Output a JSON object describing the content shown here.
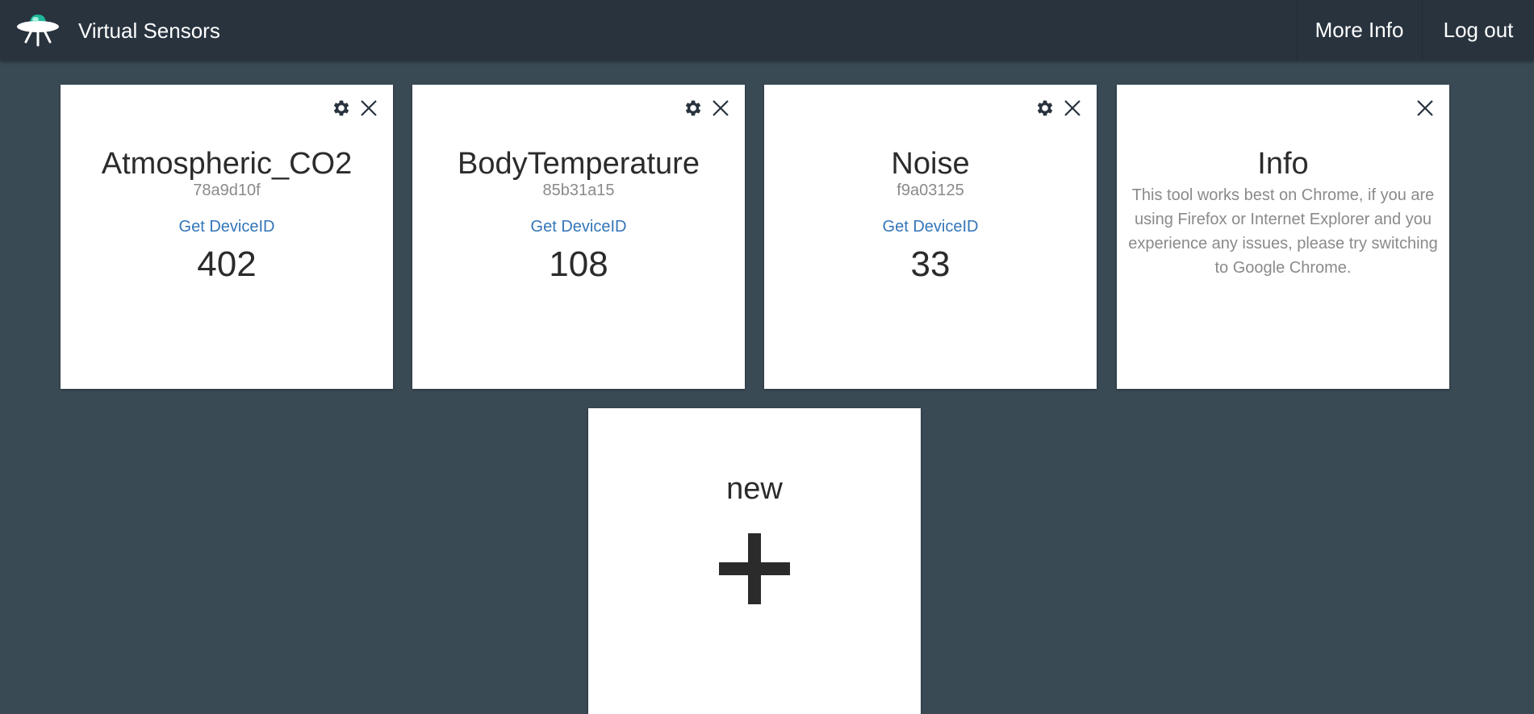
{
  "app": {
    "title": "Virtual Sensors",
    "logo_icon": "ufo-logo-icon"
  },
  "nav": {
    "more_info": "More Info",
    "logout": "Log out"
  },
  "sensors": [
    {
      "name": "Atmospheric_CO2",
      "id": "78a9d10f",
      "link": "Get DeviceID",
      "value": "402"
    },
    {
      "name": "BodyTemperature",
      "id": "85b31a15",
      "link": "Get DeviceID",
      "value": "108"
    },
    {
      "name": "Noise",
      "id": "f9a03125",
      "link": "Get DeviceID",
      "value": "33"
    }
  ],
  "info_card": {
    "title": "Info",
    "text": "This tool works best on Chrome, if you are using Firefox or Internet Explorer and you experience any issues, please try switching to Google Chrome."
  },
  "new_card": {
    "title": "new",
    "icon": "plus-icon"
  },
  "colors": {
    "background": "#3a4a55",
    "navbar": "#28333e",
    "link": "#3375b8",
    "logo_accent": "#1fb89a"
  }
}
